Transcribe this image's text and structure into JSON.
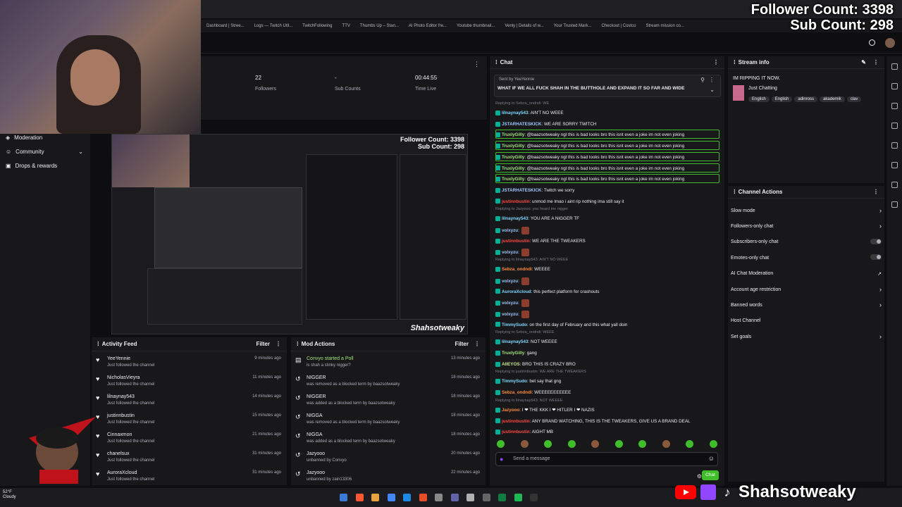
{
  "overlay": {
    "follower_count": "Follower Count: 3398",
    "sub_count": "Sub Count: 298",
    "handle": "Shahsotweaky"
  },
  "bookmarks": [
    "Dashboard | Stree...",
    "Logs — Twitch Util...",
    "TwitchFollowing",
    "TTV",
    "Thumbs Up – Stan...",
    "AI Photo Editor fre...",
    "Youtube thumbnail...",
    "Venly | Details of w...",
    "Your Trusted Mark...",
    "Checkout | Costco",
    "Stream mission co..."
  ],
  "sidebar": {
    "items": [
      {
        "label": "Moderation"
      },
      {
        "label": "Community"
      },
      {
        "label": "Drops & rewards"
      }
    ]
  },
  "stats": [
    {
      "value": "22",
      "label": "Followers"
    },
    {
      "value": "-",
      "label": "Sub Counts"
    },
    {
      "value": "00:44:55",
      "label": "Time Live"
    }
  ],
  "activity_feed": {
    "title": "Activity Feed",
    "filter": "Filter",
    "items": [
      {
        "name": "YeeYennie",
        "sub": "Just followed the channel",
        "time": "9 minutes ago"
      },
      {
        "name": "NicholasVieyra",
        "sub": "Just followed the channel",
        "time": "11 minutes ago"
      },
      {
        "name": "lilnaynay543",
        "sub": "Just followed the channel",
        "time": "14 minutes ago"
      },
      {
        "name": "justinnbustin",
        "sub": "Just followed the channel",
        "time": "15 minutes ago"
      },
      {
        "name": "Cinnaxmon",
        "sub": "Just followed the channel",
        "time": "21 minutes ago"
      },
      {
        "name": "chanelsux",
        "sub": "Just followed the channel",
        "time": "31 minutes ago"
      },
      {
        "name": "AuroraXcloud",
        "sub": "Just followed the channel",
        "time": "31 minutes ago"
      }
    ]
  },
  "mod_actions": {
    "title": "Mod Actions",
    "filter": "Filter",
    "items": [
      {
        "name": "Convyo started a Poll",
        "sub": "is shah a stinky nigger?",
        "time": "13 minutes ago"
      },
      {
        "name": "NIGGER",
        "sub": "was removed as a blocked term by baazsotweaky",
        "time": "18 minutes ago"
      },
      {
        "name": "NIGGER",
        "sub": "was added as a blocked term by baazsotweaky",
        "time": "18 minutes ago"
      },
      {
        "name": "NIGGA",
        "sub": "was removed as a blocked term by baazsotweaky",
        "time": "18 minutes ago"
      },
      {
        "name": "NIGGA",
        "sub": "was added as a blocked term by baazsotweaky",
        "time": "18 minutes ago"
      },
      {
        "name": "Jazyooo",
        "sub": "unbanned by Convyo",
        "time": "20 minutes ago"
      },
      {
        "name": "Jazyooo",
        "sub": "unbanned by zain13306",
        "time": "22 minutes ago"
      }
    ]
  },
  "chat": {
    "title": "Chat",
    "pinned_sender": "Sent by YeeYennie",
    "pinned_text": "WHAT IF WE ALL FUCK SHAH IN THE BUTTHOLE AND EXPAND IT SO FAR AND WIDE",
    "input_placeholder": "Send a message",
    "send_label": "Chat",
    "lines": [
      {
        "reply": "Replying to Sebza_ondndi: WE"
      },
      {
        "user": "lilnaynay543",
        "text": ": AIN'T NO WEEE",
        "color": "#7fd8ff"
      },
      {
        "user": "JSTARHATESKICK",
        "text": ": WE ARE SORRY TWITCH",
        "color": "#9fc7ff"
      },
      {
        "user": "TruxlyGilly",
        "text": ": @baazsotweaky ngl this is bad looks bro this isnt even a joke im not even joking",
        "color": "#a3e37d"
      },
      {
        "user": "TruxlyGilly",
        "text": ": @baazsotweaky ngl this is bad looks bro this isnt even a joke im not even joking",
        "color": "#a3e37d"
      },
      {
        "user": "TruxlyGilly",
        "text": ": @baazsotweaky ngl this is bad looks bro this isnt even a joke im not even joking",
        "color": "#a3e37d"
      },
      {
        "user": "TruxlyGilly",
        "text": ": @baazsotweaky ngl this is bad looks bro this isnt even a joke im not even joking",
        "color": "#a3e37d"
      },
      {
        "user": "TruxlyGilly",
        "text": ": @baazsotweaky ngl this is bad looks bro this isnt even a joke im not even joking",
        "color": "#a3e37d"
      },
      {
        "user": "JSTARHATESKICK",
        "text": ": Twitch we sorry",
        "color": "#9fc7ff"
      },
      {
        "user": "justinnbustin",
        "text": ": unmod me lmao i aint rip nothing ima still say it",
        "color": "#ff4545"
      },
      {
        "reply": "Replying to Jazyooo: you heard me nigger"
      },
      {
        "user": "lilnaynay543",
        "text": ": YOU ARE A NIGGER TF",
        "color": "#7fd8ff"
      },
      {
        "user": "volxyzu",
        "text": ":",
        "color": "#9fc7ff",
        "emote": true
      },
      {
        "user": "justinnbustin",
        "text": ": WE ARE THE TWEAKERS",
        "color": "#ff4545"
      },
      {
        "user": "volxyzu",
        "text": ":",
        "color": "#9fc7ff",
        "emote": true
      },
      {
        "reply": "Replying to lilnaynay543: AIN'T NO WEEE"
      },
      {
        "user": "Sebza_ondndi",
        "text": ": WEEEE",
        "color": "#ff8c3a"
      },
      {
        "user": "volxyzu",
        "text": ":",
        "color": "#9fc7ff",
        "emote": true
      },
      {
        "user": "AuroraXcloud",
        "text": ": this perfect platform for crashouts",
        "color": "#7fd8ff"
      },
      {
        "user": "volxyzu",
        "text": ":",
        "color": "#9fc7ff",
        "emote": true
      },
      {
        "user": "volxyzu",
        "text": ":",
        "color": "#9fc7ff",
        "emote": true
      },
      {
        "user": "TimmySudo",
        "text": ": on the first day of February and this what yall doin",
        "color": "#7fd8ff"
      },
      {
        "reply": "Replying to Sebza_ondndi: WEEE"
      },
      {
        "user": "lilnaynay543",
        "text": ": NOT WEEEE",
        "color": "#7fd8ff"
      },
      {
        "user": "TruxlyGilly",
        "text": ": gang",
        "color": "#a3e37d"
      },
      {
        "user": "AIIEYOS",
        "text": ": BRO THIS IS CRAZY BRO",
        "color": "#c8e68b"
      },
      {
        "reply": "Replying to justinnbustin: WE ARE THE TWEAKERS"
      },
      {
        "user": "TimmySudo",
        "text": ": bet say that gng",
        "color": "#7fd8ff"
      },
      {
        "user": "Sebza_ondndi",
        "text": ": WEEEEEEEEEEE",
        "color": "#ff8c3a"
      },
      {
        "reply": "Replying to lilnaynay543: NOT WEEEE"
      },
      {
        "user": "Jazyooo",
        "text": ": I ❤ THE KKK I ❤ HITLER I ❤ NAZIS",
        "color": "#ff8c3a"
      },
      {
        "user": "justinnbustin",
        "text": ": ANY BRAND WATCHING, THIS IS THE TWEAKERS, GIVE US A BRAND DEAL",
        "color": "#ff4545"
      },
      {
        "user": "justinnbustin",
        "text": ": AIGHT MB",
        "color": "#ff4545"
      }
    ]
  },
  "stream_info": {
    "title": "Stream info",
    "stream_title": "IM RIPPING IT NOW.",
    "category": "Just Chatting",
    "tags": [
      "English",
      "English",
      "adinross",
      "akademik",
      "clav"
    ]
  },
  "channel_actions": {
    "title": "Channel Actions",
    "items": [
      {
        "label": "Slow mode",
        "ctl": "chevron"
      },
      {
        "label": "Followers-only chat",
        "ctl": "chevron"
      },
      {
        "label": "Subscribers-only chat",
        "ctl": "toggle"
      },
      {
        "label": "Emotes-only chat",
        "ctl": "toggle"
      },
      {
        "label": "AI Chat Moderation",
        "ctl": "external"
      },
      {
        "label": "Account age restriction",
        "ctl": "chevron"
      },
      {
        "label": "Banned words",
        "ctl": "chevron"
      },
      {
        "label": "Host Channel",
        "ctl": "none"
      },
      {
        "label": "Set goals",
        "ctl": "chevron"
      }
    ]
  },
  "taskbar": {
    "temp": "52°F",
    "weather": "Cloudy"
  },
  "colors": {
    "twitch_purple": "#9146ff",
    "highlight_green": "#3fbd2b",
    "youtube_red": "#ff0000"
  }
}
